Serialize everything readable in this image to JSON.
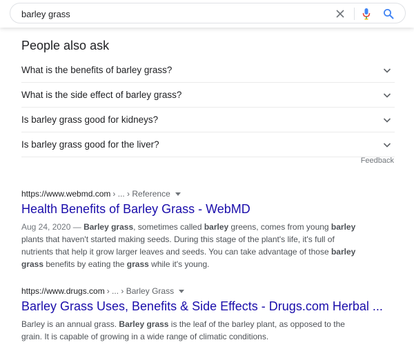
{
  "search": {
    "query": "barley grass"
  },
  "people_also_ask": {
    "title": "People also ask",
    "questions": [
      "What is the benefits of barley grass?",
      "What is the side effect of barley grass?",
      "Is barley grass good for kidneys?",
      "Is barley grass good for the liver?"
    ],
    "feedback": "Feedback"
  },
  "results": [
    {
      "url": "https://www.webmd.com",
      "breadcrumb": "› ... › Reference",
      "title": "Health Benefits of Barley Grass - WebMD",
      "date": "Aug 24, 2020 —",
      "snippet_parts": [
        {
          "t": " ",
          "b": false
        },
        {
          "t": "Barley grass",
          "b": true
        },
        {
          "t": ", sometimes called ",
          "b": false
        },
        {
          "t": "barley",
          "b": true
        },
        {
          "t": " greens, comes from young ",
          "b": false
        },
        {
          "t": "barley",
          "b": true
        },
        {
          "t": " plants that haven't started making seeds. During this stage of the plant's life, it's full of nutrients that help it grow larger leaves and seeds. You can take advantage of those ",
          "b": false
        },
        {
          "t": "barley grass",
          "b": true
        },
        {
          "t": " benefits by eating the ",
          "b": false
        },
        {
          "t": "grass",
          "b": true
        },
        {
          "t": " while it's young.",
          "b": false
        }
      ]
    },
    {
      "url": "https://www.drugs.com",
      "breadcrumb": "› ... › Barley Grass",
      "title": "Barley Grass Uses, Benefits & Side Effects - Drugs.com Herbal ...",
      "date": "",
      "snippet_parts": [
        {
          "t": "Barley is an annual grass. ",
          "b": false
        },
        {
          "t": "Barley grass",
          "b": true
        },
        {
          "t": " is the leaf of the barley plant, as opposed to the grain. It is capable of growing in a wide range of climatic conditions.",
          "b": false
        }
      ]
    }
  ],
  "icons": {
    "clear": "close-icon",
    "mic": "microphone-icon",
    "search": "search-icon",
    "chevron": "chevron-down-icon"
  },
  "colors": {
    "link": "#1a0dab",
    "mic_blue": "#4285f4",
    "mic_red": "#ea4335",
    "search_blue": "#4285f4"
  }
}
